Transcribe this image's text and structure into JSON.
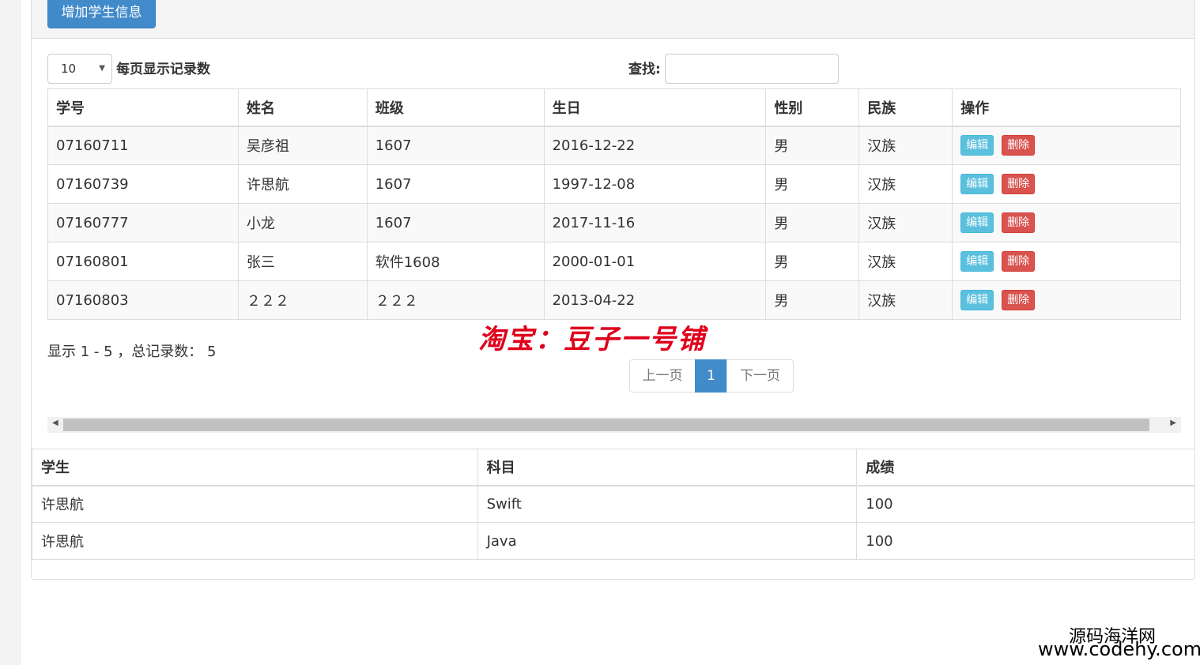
{
  "toolbar": {
    "add_label": "增加学生信息"
  },
  "controls": {
    "page_length": "10",
    "page_length_label": "每页显示记录数",
    "search_label": "查找:",
    "search_value": ""
  },
  "main_table": {
    "headers": [
      "学号",
      "姓名",
      "班级",
      "生日",
      "性别",
      "民族",
      "操作"
    ],
    "rows": [
      [
        "07160711",
        "吴彦祖",
        "1607",
        "2016-12-22",
        "男",
        "汉族"
      ],
      [
        "07160739",
        "许思航",
        "1607",
        "1997-12-08",
        "男",
        "汉族"
      ],
      [
        "07160777",
        "小龙",
        "1607",
        "2017-11-16",
        "男",
        "汉族"
      ],
      [
        "07160801",
        "张三",
        "软件1608",
        "2000-01-01",
        "男",
        "汉族"
      ],
      [
        "07160803",
        "２２２",
        "２２２",
        "2013-04-22",
        "男",
        "汉族"
      ]
    ],
    "edit_label": "编辑",
    "delete_label": "删除"
  },
  "footer": {
    "info": "显示 1 - 5 ，总记录数： 5",
    "prev": "上一页",
    "page": "1",
    "next": "下一页"
  },
  "watermark": "淘宝：豆子一号铺",
  "score_table": {
    "headers": [
      "学生",
      "科目",
      "成绩"
    ],
    "rows": [
      [
        "许思航",
        "Swift",
        "100"
      ],
      [
        "许思航",
        "Java",
        "100"
      ]
    ]
  },
  "site": {
    "name": "源码海洋网",
    "url": "www.codehy.com"
  }
}
